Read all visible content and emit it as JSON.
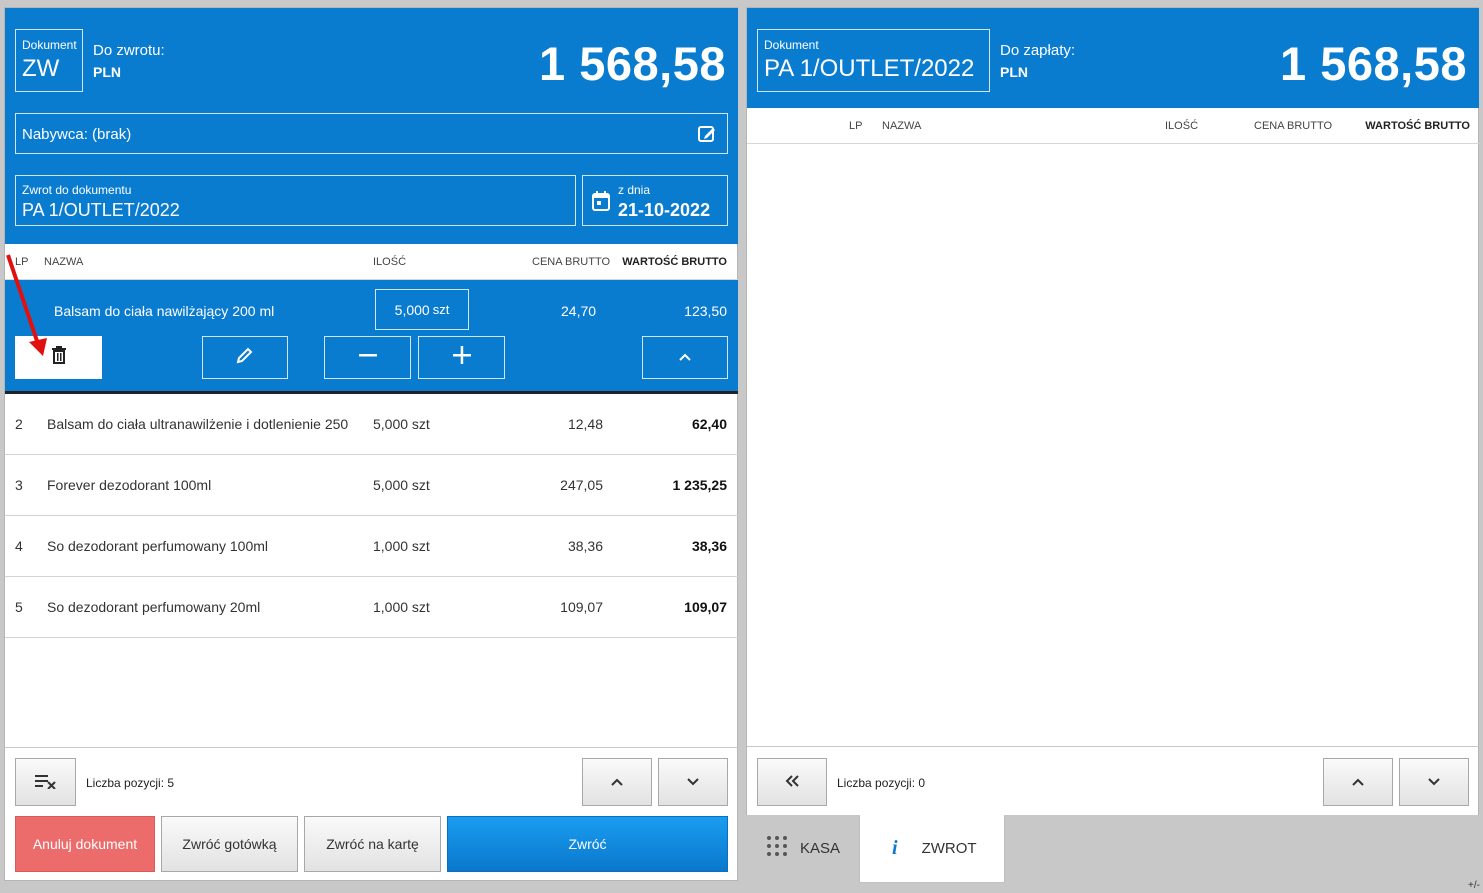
{
  "left": {
    "doc_caption": "Dokument",
    "doc_value": "ZW",
    "title": "Do zwrotu:",
    "currency": "PLN",
    "amount": "1 568,58",
    "buyer": "Nabywca: (brak)",
    "return_caption": "Zwrot do dokumentu",
    "return_value": "PA 1/OUTLET/2022",
    "date_caption": "z dnia",
    "date_value": "21-10-2022",
    "headers": {
      "lp": "LP",
      "name": "NAZWA",
      "qty": "ILOŚĆ",
      "price": "CENA BRUTTO",
      "value": "WARTOŚĆ BRUTTO"
    },
    "selected": {
      "name": "Balsam do ciała nawilżający 200 ml",
      "qty_num": "5,000",
      "qty_unit": "szt",
      "price": "24,70",
      "value": "123,50"
    },
    "rows": [
      {
        "lp": "2",
        "name": "Balsam do ciała ultranawilżenie i dotlenienie 250",
        "qty": "5,000 szt",
        "price": "12,48",
        "value": "62,40"
      },
      {
        "lp": "3",
        "name": "Forever dezodorant 100ml",
        "qty": "5,000 szt",
        "price": "247,05",
        "value": "1 235,25"
      },
      {
        "lp": "4",
        "name": "So dezodorant perfumowany 100ml",
        "qty": "1,000 szt",
        "price": "38,36",
        "value": "38,36"
      },
      {
        "lp": "5",
        "name": "So dezodorant perfumowany 20ml",
        "qty": "1,000 szt",
        "price": "109,07",
        "value": "109,07"
      }
    ],
    "count_label": "Liczba pozycji: 5",
    "actions": {
      "cancel": "Anuluj dokument",
      "cash": "Zwróć gotówką",
      "card": "Zwróć na kartę",
      "return": "Zwróć"
    }
  },
  "right": {
    "doc_caption": "Dokument",
    "doc_value": "PA 1/OUTLET/2022",
    "title": "Do zapłaty:",
    "currency": "PLN",
    "amount": "1 568,58",
    "headers": {
      "lp": "LP",
      "name": "NAZWA",
      "qty": "ILOŚĆ",
      "price": "CENA BRUTTO",
      "value": "WARTOŚĆ BRUTTO"
    },
    "count_label": "Liczba pozycji: 0"
  },
  "tabs": {
    "kasa": "KASA",
    "zwrot": "ZWROT"
  },
  "corner": "+/-",
  "colors": {
    "accent": "#0a7ccf",
    "cancel": "#ec6b6b",
    "primary": "#1188e0"
  },
  "icons": [
    "edit-icon",
    "calendar-icon",
    "trash-icon",
    "pencil-icon",
    "minus-icon",
    "plus-icon",
    "chevron-up-icon",
    "chevron-down-icon",
    "clear-list-icon",
    "double-chevron-left-icon",
    "keypad-icon",
    "info-icon"
  ]
}
